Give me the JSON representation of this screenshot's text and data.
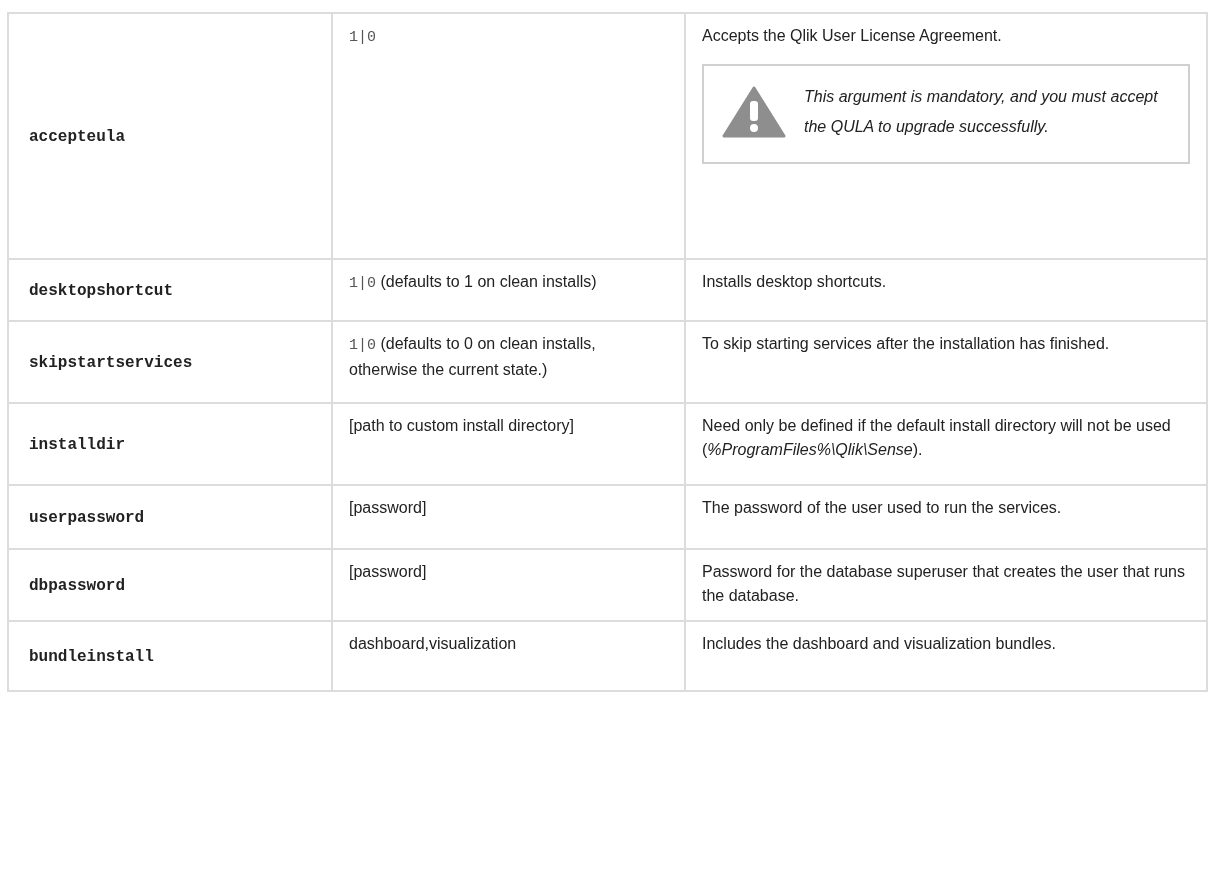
{
  "table": {
    "rows": [
      {
        "argument": "accepteula",
        "value_code": "1|0",
        "description": "Accepts the Qlik User License Agreement.",
        "warning": "This argument is mandatory, and you must accept the QULA to upgrade successfully."
      },
      {
        "argument": "desktopshortcut",
        "value_code": "1|0",
        "value_text": "(defaults to 1 on clean installs)",
        "description": "Installs desktop shortcuts."
      },
      {
        "argument": "skipstartservices",
        "value_code": "1|0",
        "value_text": "(defaults to 0 on clean installs, otherwise the current state.)",
        "description": "To skip starting services after the installation has finished."
      },
      {
        "argument": "installdir",
        "value_text": "[path to custom install directory]",
        "description": "Need only be defined if the default install directory will not be used (*%ProgramFiles%\\Qlik\\Sense*)."
      },
      {
        "argument": "userpassword",
        "value_text": "[password]",
        "description": "The password of the user used to run the services."
      },
      {
        "argument": "dbpassword",
        "value_text": "[password]",
        "description": "Password for the database superuser that creates the user that runs the database."
      },
      {
        "argument": "bundleinstall",
        "value_text": "dashboard,visualization",
        "description": "Includes the dashboard and visualization bundles."
      }
    ]
  }
}
